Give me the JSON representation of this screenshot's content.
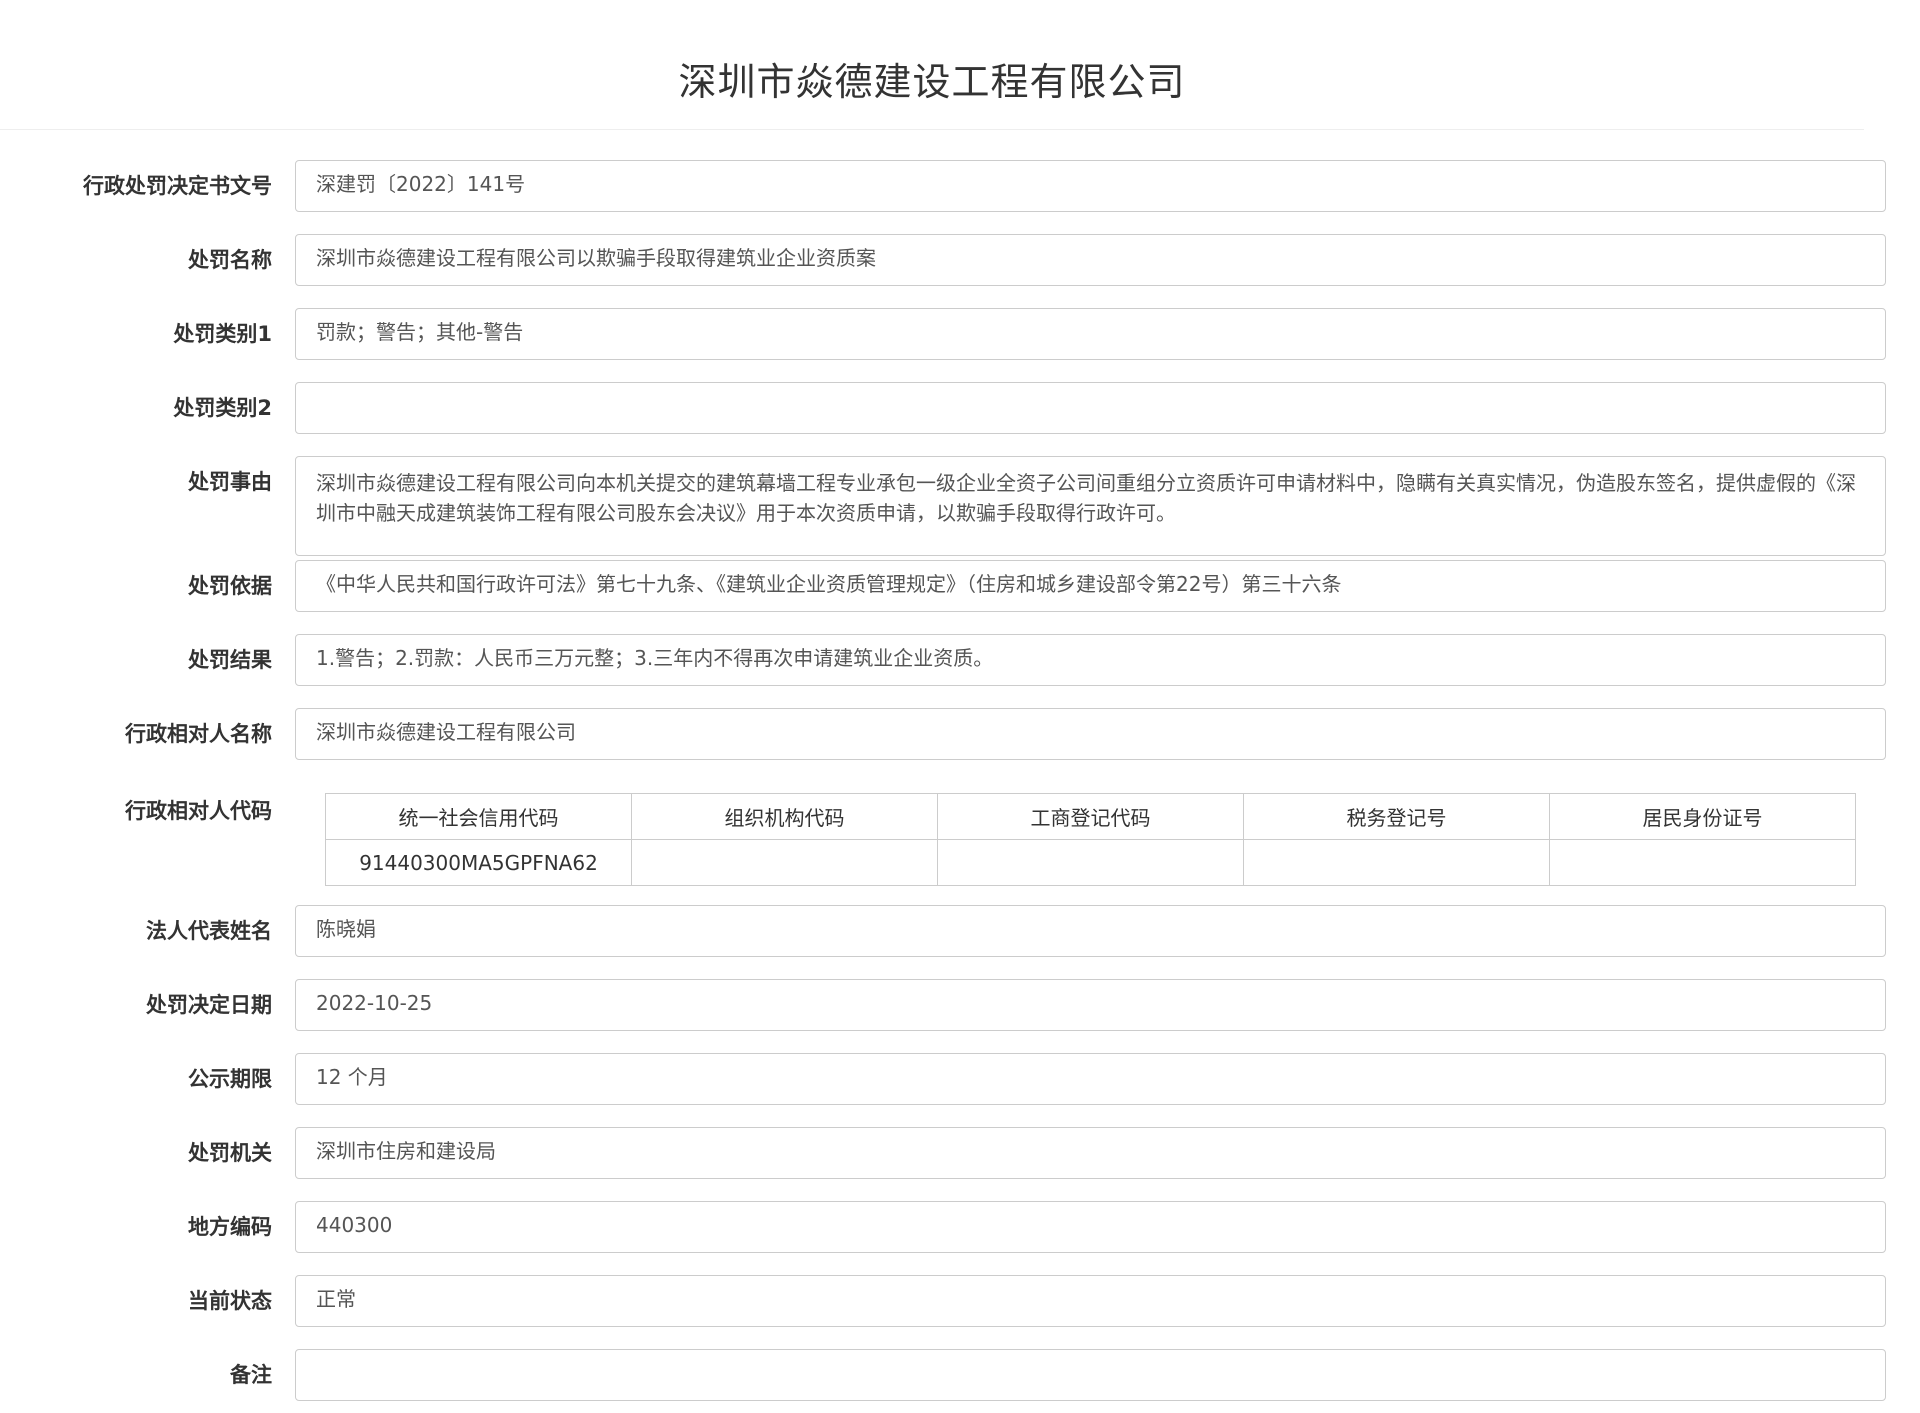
{
  "page_title": "深圳市焱德建设工程有限公司",
  "fields": {
    "decision_no": {
      "label": "行政处罚决定书文号",
      "value": "深建罚〔2022〕141号"
    },
    "penalty_name": {
      "label": "处罚名称",
      "value": "深圳市焱德建设工程有限公司以欺骗手段取得建筑业企业资质案"
    },
    "category1": {
      "label": "处罚类别1",
      "value": "罚款；警告；其他-警告"
    },
    "category2": {
      "label": "处罚类别2",
      "value": ""
    },
    "reason": {
      "label": "处罚事由",
      "value": "深圳市焱德建设工程有限公司向本机关提交的建筑幕墙工程专业承包一级企业全资子公司间重组分立资质许可申请材料中，隐瞒有关真实情况，伪造股东签名，提供虚假的《深圳市中融天成建筑装饰工程有限公司股东会决议》用于本次资质申请，以欺骗手段取得行政许可。"
    },
    "basis": {
      "label": "处罚依据",
      "value": "《中华人民共和国行政许可法》第七十九条、《建筑业企业资质管理规定》（住房和城乡建设部令第22号）第三十六条"
    },
    "result": {
      "label": "处罚结果",
      "value": "1.警告；2.罚款：人民币三万元整；3.三年内不得再次申请建筑业企业资质。"
    },
    "party_name": {
      "label": "行政相对人名称",
      "value": "深圳市焱德建设工程有限公司"
    },
    "party_code_label": "行政相对人代码",
    "legal_rep": {
      "label": "法人代表姓名",
      "value": "陈晓娟"
    },
    "decision_date": {
      "label": "处罚决定日期",
      "value": "2022-10-25"
    },
    "publicity_period": {
      "label": "公示期限",
      "value": "12 个月"
    },
    "authority": {
      "label": "处罚机关",
      "value": "深圳市住房和建设局"
    },
    "region_code": {
      "label": "地方编码",
      "value": "440300"
    },
    "status": {
      "label": "当前状态",
      "value": "正常"
    },
    "remarks": {
      "label": "备注",
      "value": ""
    }
  },
  "code_table": {
    "headers": [
      "统一社会信用代码",
      "组织机构代码",
      "工商登记代码",
      "税务登记号",
      "居民身份证号"
    ],
    "row": [
      "91440300MA5GPFNA62",
      "",
      "",
      "",
      ""
    ]
  }
}
